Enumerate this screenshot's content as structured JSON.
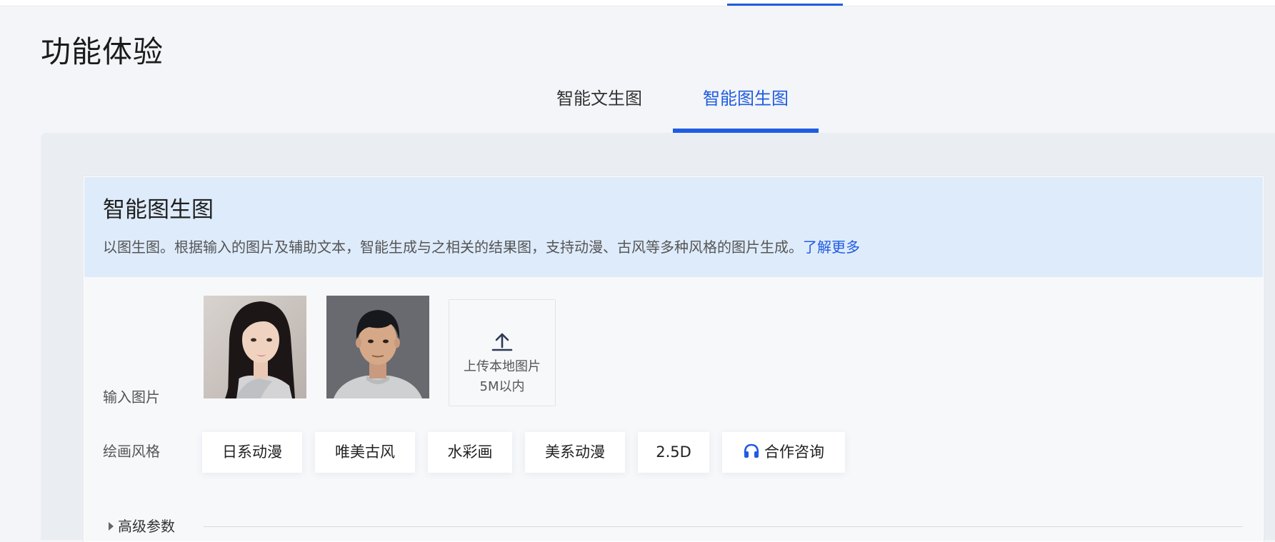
{
  "page": {
    "title": "功能体验"
  },
  "tabs": [
    {
      "label": "智能文生图",
      "active": false
    },
    {
      "label": "智能图生图",
      "active": true
    }
  ],
  "card": {
    "title": "智能图生图",
    "description": "以图生图。根据输入的图片及辅助文本，智能生成与之相关的结果图，支持动漫、古风等多种风格的图片生成。",
    "learn_more": "了解更多"
  },
  "input_images": {
    "label": "输入图片",
    "samples": [
      {
        "name": "sample-portrait-girl"
      },
      {
        "name": "sample-portrait-boy"
      }
    ],
    "upload": {
      "icon": "upload-icon",
      "line1": "上传本地图片",
      "line2": "5M以内"
    }
  },
  "styles": {
    "label": "绘画风格",
    "options": [
      "日系动漫",
      "唯美古风",
      "水彩画",
      "美系动漫",
      "2.5D"
    ],
    "consult": {
      "icon": "headset-icon",
      "label": "合作咨询"
    }
  },
  "advanced": {
    "label": "高级参数"
  },
  "colors": {
    "accent": "#1f5ce0",
    "header_bg": "#deebfb",
    "page_bg": "#f3f5f8"
  }
}
